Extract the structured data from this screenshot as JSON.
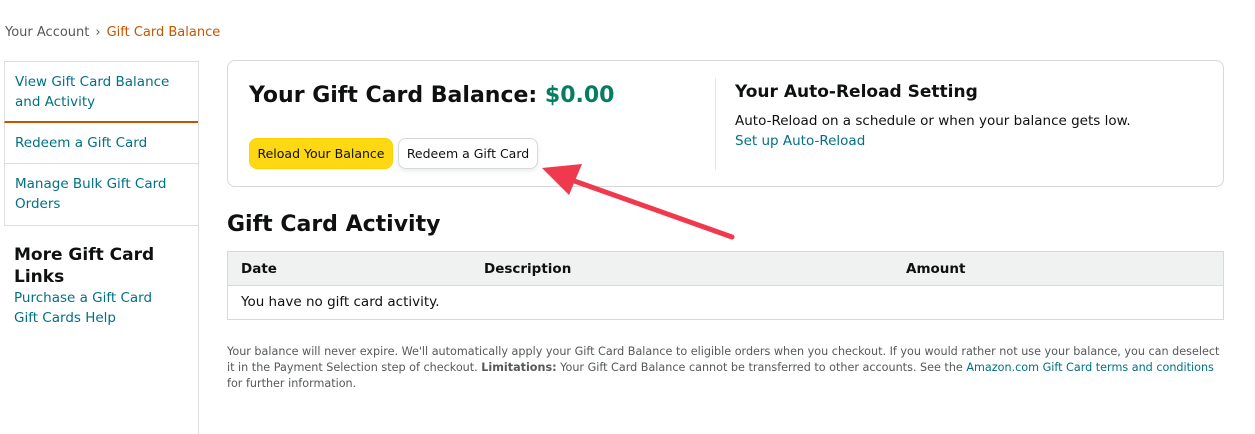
{
  "breadcrumb": {
    "parent": "Your Account",
    "separator": "›",
    "current": "Gift Card Balance"
  },
  "sidebar": {
    "items": [
      {
        "label": "View Gift Card Balance and Activity",
        "active": true
      },
      {
        "label": "Redeem a Gift Card",
        "active": false
      },
      {
        "label": "Manage Bulk Gift Card Orders",
        "active": false
      }
    ],
    "more_links": {
      "title": "More Gift Card Links",
      "links": [
        "Purchase a Gift Card",
        "Gift Cards Help"
      ]
    }
  },
  "balance": {
    "label": "Your Gift Card Balance:",
    "amount": "$0.00",
    "reload_button": "Reload Your Balance",
    "redeem_button": "Redeem a Gift Card"
  },
  "auto_reload": {
    "title": "Your Auto-Reload Setting",
    "description": "Auto-Reload on a schedule or when your balance gets low.",
    "link": "Set up Auto-Reload"
  },
  "activity": {
    "title": "Gift Card Activity",
    "columns": [
      "Date",
      "Description",
      "Amount"
    ],
    "empty_message": "You have no gift card activity."
  },
  "footnote": {
    "part1": "Your balance will never expire. We'll automatically apply your Gift Card Balance to eligible orders when you checkout. If you would rather not use your balance, you can deselect it in the Payment Selection step of checkout. ",
    "limitations_label": "Limitations:",
    "part2": " Your Gift Card Balance cannot be transferred to other accounts. See the ",
    "link": "Amazon.com Gift Card terms and conditions",
    "part3": " for further information."
  },
  "colors": {
    "link": "#007185",
    "accent_orange": "#c45500",
    "balance_green": "#067d62",
    "reload_button_bg": "#ffd814",
    "annotation_arrow": "#f0394d"
  },
  "annotation": {
    "icon": "red-arrow-icon",
    "points_to": "Redeem a Gift Card"
  }
}
